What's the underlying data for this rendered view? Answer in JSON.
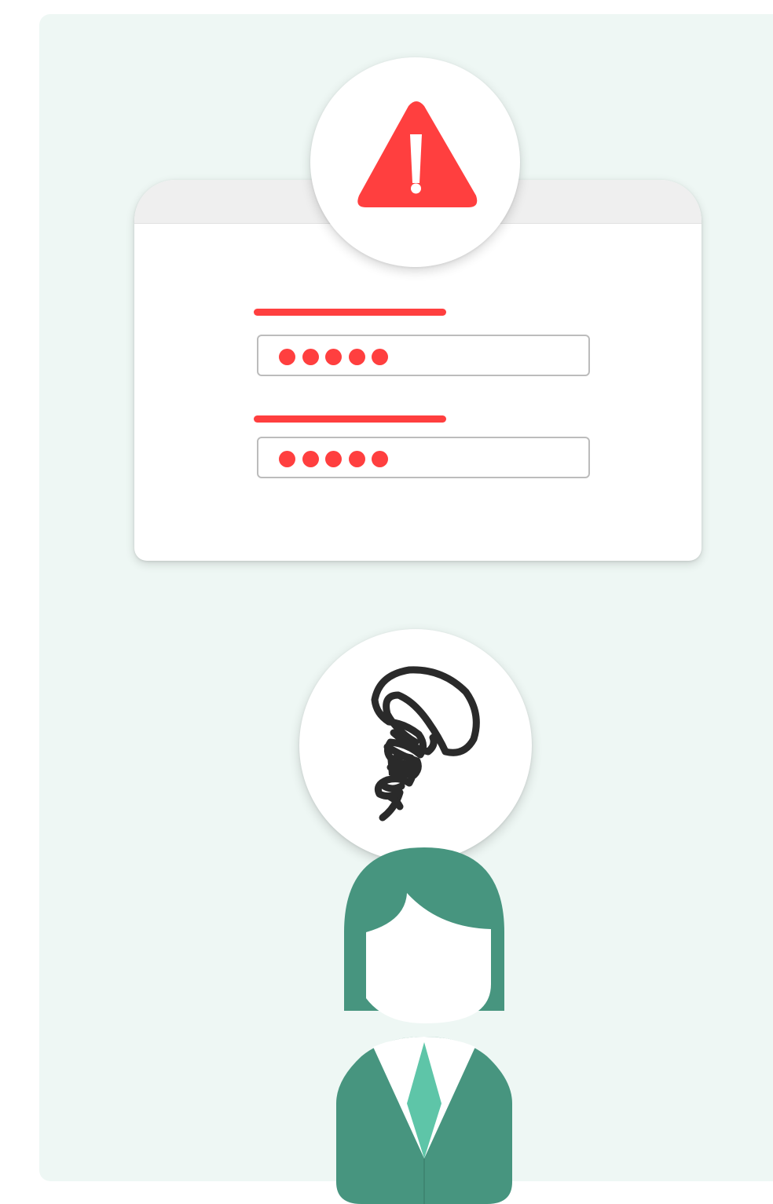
{
  "colors": {
    "background": "#eef7f4",
    "accent_red": "#ff3f3f",
    "field_border": "#bcbcbc",
    "titlebar": "#efefef",
    "hair_and_suit": "#47957f",
    "tie": "#5ec5a8",
    "scribble": "#2a2a2a"
  },
  "icons": {
    "warning": "warning-triangle-icon",
    "thought": "tangled-scribble-icon",
    "user": "person-avatar"
  },
  "login_form": {
    "fields": [
      {
        "name": "first-password-field",
        "masked_character_count": 5
      },
      {
        "name": "second-password-field",
        "masked_character_count": 5
      }
    ]
  }
}
